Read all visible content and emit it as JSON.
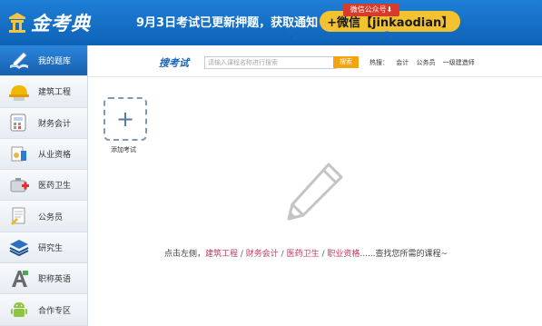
{
  "header": {
    "logo_text": "金考典",
    "banner_part1": "9月3日考试已更新押题，获取通知",
    "banner_part2": "+微信【jinkaodian】",
    "wechat_badge": "微信公众号⬇"
  },
  "sidebar": {
    "items": [
      {
        "label": "我的题库",
        "icon": "pen-book-icon"
      },
      {
        "label": "建筑工程",
        "icon": "hard-hat-icon"
      },
      {
        "label": "财务会计",
        "icon": "calculator-icon"
      },
      {
        "label": "从业资格",
        "icon": "certificate-icon"
      },
      {
        "label": "医药卫生",
        "icon": "medical-kit-icon"
      },
      {
        "label": "公务员",
        "icon": "document-icon"
      },
      {
        "label": "研究生",
        "icon": "layers-icon"
      },
      {
        "label": "职称英语",
        "icon": "letter-a-icon"
      },
      {
        "label": "合作专区",
        "icon": "android-icon"
      }
    ]
  },
  "search": {
    "title": "搜考试",
    "placeholder": "请输入课程名称进行搜索",
    "button_label": "搜索",
    "hot_label": "热搜：",
    "hot_items": [
      "会计",
      "公务员",
      "一级建造师"
    ]
  },
  "main": {
    "add_label": "添加考试",
    "hint_prefix": "点击左侧，",
    "hint_links": [
      "建筑工程",
      "财务会计",
      "医药卫生",
      "职业资格"
    ],
    "hint_separator": " / ",
    "hint_suffix": "......查找您所需的课程~"
  }
}
